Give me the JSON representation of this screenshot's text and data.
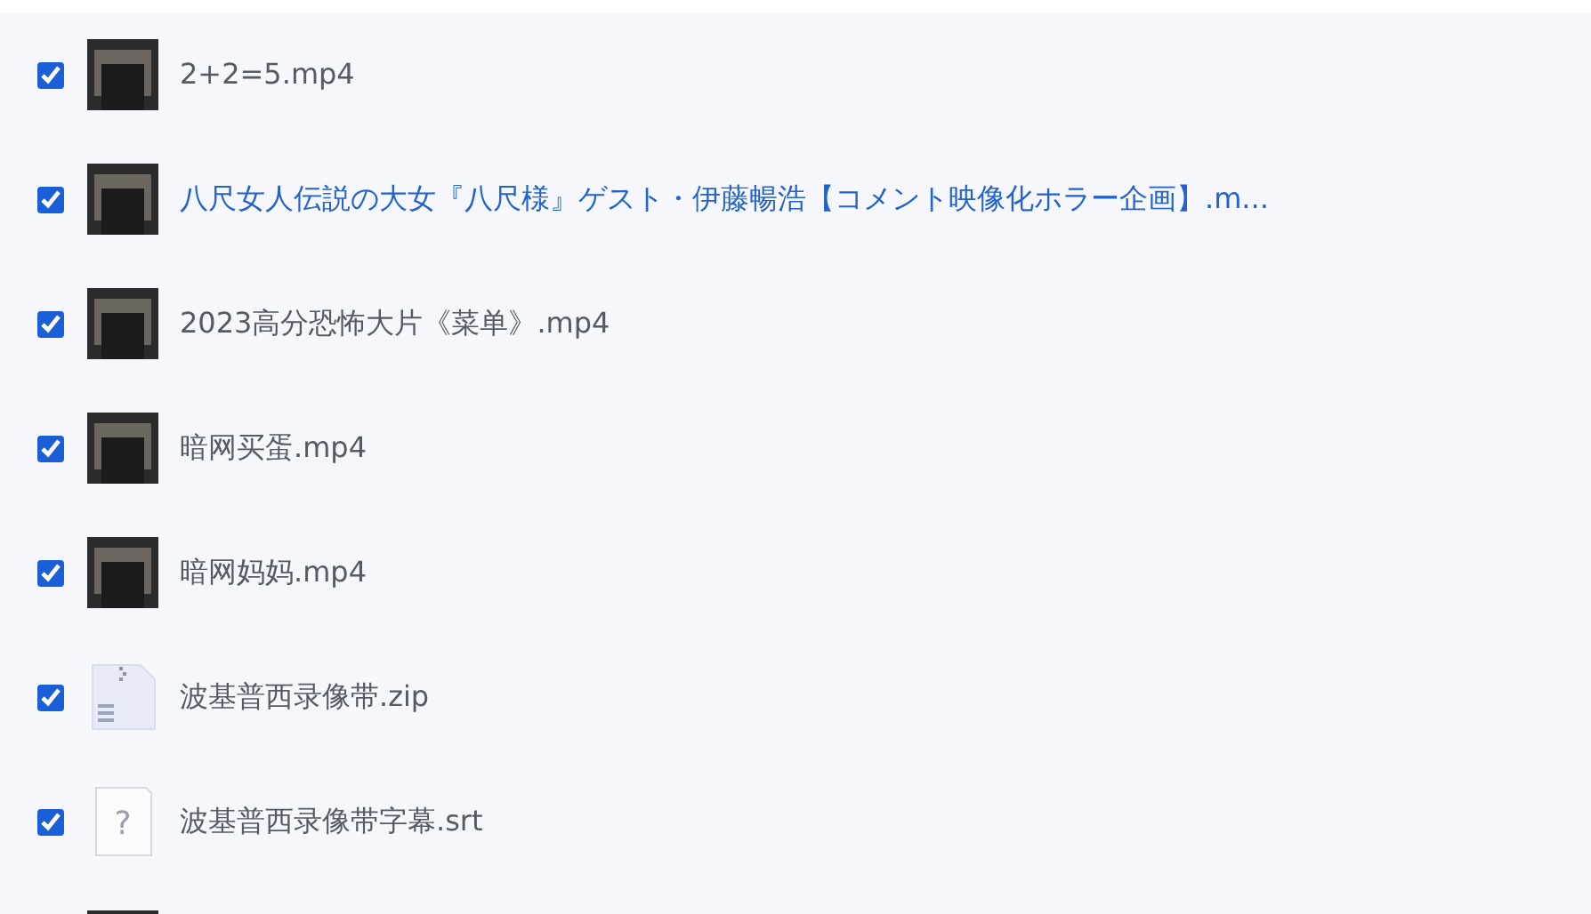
{
  "files": [
    {
      "kind": "video",
      "name": "2+2=5.mp4",
      "checked": true,
      "highlighted": false
    },
    {
      "kind": "video",
      "name": "八尺女人伝説の大女『八尺様』ゲスト・伊藤暢浩【コメント映像化ホラー企画】.m...",
      "checked": true,
      "highlighted": true
    },
    {
      "kind": "video",
      "name": "2023高分恐怖大片《菜单》.mp4",
      "checked": true,
      "highlighted": false
    },
    {
      "kind": "video",
      "name": "暗网买蛋.mp4",
      "checked": true,
      "highlighted": false
    },
    {
      "kind": "video",
      "name": "暗网妈妈.mp4",
      "checked": true,
      "highlighted": false
    },
    {
      "kind": "zip",
      "name": "波基普西录像带.zip",
      "checked": true,
      "highlighted": false
    },
    {
      "kind": "unknown",
      "icon_glyph": "?",
      "name": "波基普西录像带字幕.srt",
      "checked": true,
      "highlighted": false
    },
    {
      "kind": "video"
    }
  ]
}
